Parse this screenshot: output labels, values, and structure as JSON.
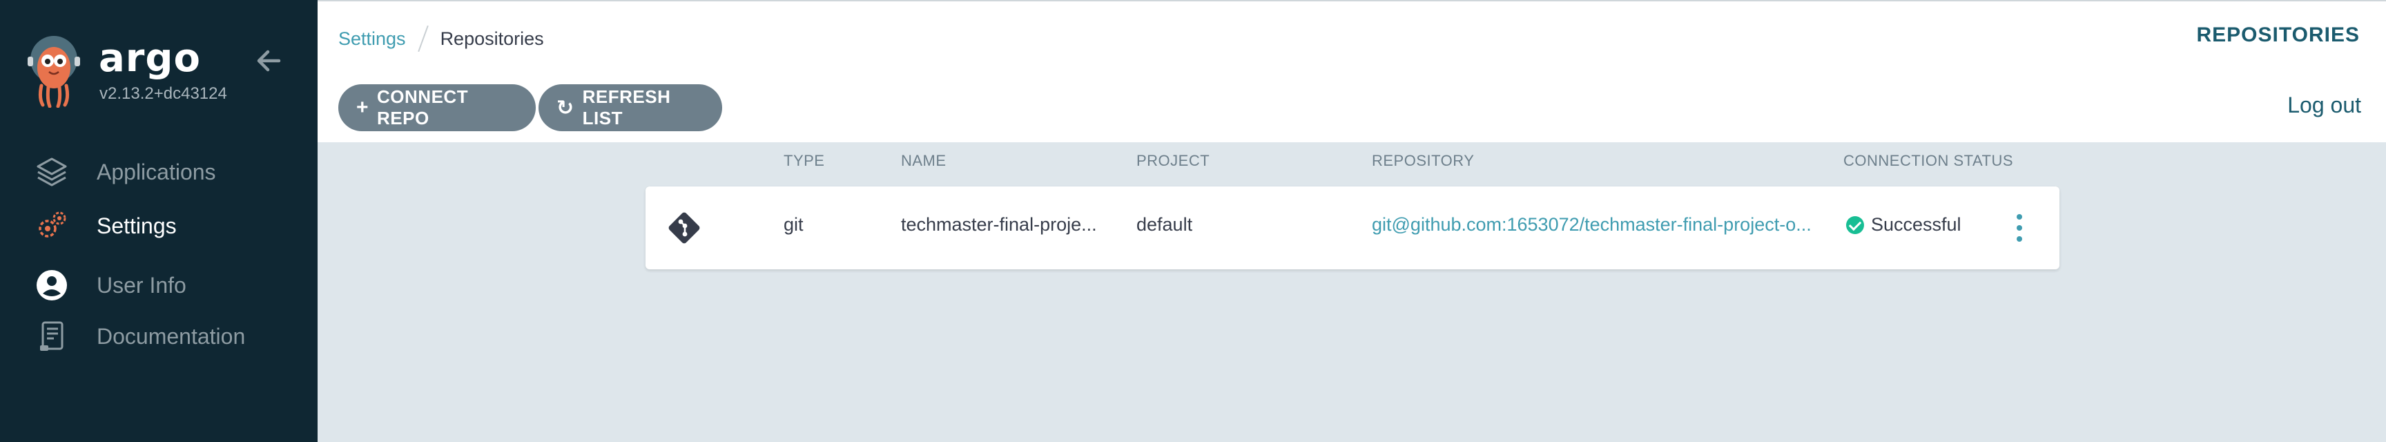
{
  "sidebar": {
    "brand": "argo",
    "version": "v2.13.2+dc43124",
    "items": [
      {
        "label": "Applications",
        "icon": "layers-icon",
        "active": false
      },
      {
        "label": "Settings",
        "icon": "gears-icon",
        "active": true
      },
      {
        "label": "User Info",
        "icon": "user-circle-icon",
        "active": false
      },
      {
        "label": "Documentation",
        "icon": "book-icon",
        "active": false
      }
    ]
  },
  "header": {
    "breadcrumb": {
      "parent": "Settings",
      "current": "Repositories"
    },
    "title": "REPOSITORIES"
  },
  "toolbar": {
    "connect_label": "CONNECT REPO",
    "refresh_label": "REFRESH LIST",
    "logout_label": "Log out"
  },
  "table": {
    "columns": [
      "TYPE",
      "NAME",
      "PROJECT",
      "REPOSITORY",
      "CONNECTION STATUS"
    ],
    "rows": [
      {
        "type": "git",
        "name": "techmaster-final-proje...",
        "project": "default",
        "repository": "git@github.com:1653072/techmaster-final-project-o...",
        "status": "Successful"
      }
    ]
  },
  "colors": {
    "sidebar_bg": "#0f2733",
    "accent": "#3f9cb0",
    "button_bg": "#6d7f8b",
    "success": "#18be94",
    "content_bg": "#dee6eb"
  }
}
